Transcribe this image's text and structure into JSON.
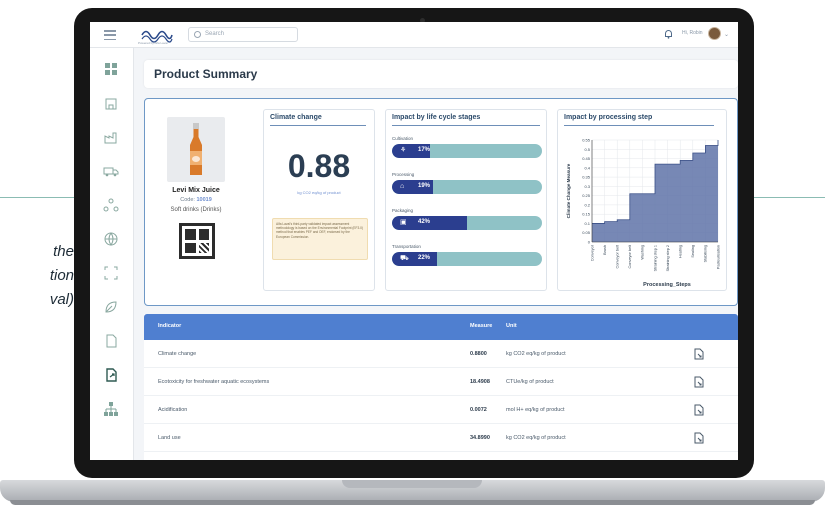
{
  "caption": {
    "lines": [
      "the",
      "tion",
      "val)"
    ]
  },
  "topbar": {
    "search_placeholder": "Search",
    "user_label": "Hi, Robin",
    "logo_tagline": "Powered by Alfa Laval"
  },
  "page_title": "Product Summary",
  "product": {
    "name": "Levi Mix Juice",
    "code_label": "Code:",
    "code_value": "10019",
    "category": "Soft drinks (Drinks)"
  },
  "climate": {
    "title": "Climate change",
    "value": "0.88",
    "unit": "kg CO2 eq/kg of product",
    "note": "Alfa Laval's third-party validated impact assessment methodology is based on the Environmental Footprint (EF3.0) method that enables PEF and OEF, endorsed by the European Commission."
  },
  "stages": {
    "title": "Impact by life cycle stages",
    "items": [
      {
        "label": "Cultivation",
        "icon": "sprout-icon",
        "percent_text": "17%",
        "percent": 17
      },
      {
        "label": "Processing",
        "icon": "factory-icon",
        "percent_text": "19%",
        "percent": 19
      },
      {
        "label": "Packaging",
        "icon": "package-icon",
        "percent_text": "42%",
        "percent": 42
      },
      {
        "label": "Transportation",
        "icon": "truck-icon",
        "percent_text": "22%",
        "percent": 22
      }
    ],
    "colors": {
      "track": "#8fc2c6",
      "fill": "#2b3e8f"
    }
  },
  "processing": {
    "title": "Impact by processing step"
  },
  "chart_data": {
    "type": "area",
    "title": "Impact by processing step",
    "xlabel": "Processing_Steps",
    "ylabel": "Climate Change Measure",
    "categories": [
      "Conveyor",
      "Brush",
      "Conveyor belt",
      "Conveyor belt",
      "Washing",
      "Straining step 1",
      "Straining step 2",
      "Heating",
      "Sealing",
      "Stabilising",
      "Pasteurisation"
    ],
    "values": [
      0.1,
      0.11,
      0.12,
      0.26,
      0.26,
      0.42,
      0.42,
      0.44,
      0.48,
      0.52,
      0.55
    ],
    "y_ticks": [
      "0",
      "0.05",
      "0.1",
      "0.15",
      "0.2",
      "0.25",
      "0.3",
      "0.35",
      "0.4",
      "0.45",
      "0.5",
      "0.55"
    ],
    "ylim": [
      0,
      0.55
    ],
    "grid": true,
    "fill_color": "#5f73a8",
    "line_color": "#3a4f86"
  },
  "table": {
    "headers": [
      "Indicator",
      "Measure",
      "Unit"
    ],
    "rows": [
      {
        "indicator": "Climate change",
        "measure": "0.8800",
        "unit": "kg CO2 eq/kg of product"
      },
      {
        "indicator": "Ecotoxicity for freshwater aquatic ecosystems",
        "measure": "18.4908",
        "unit": "CTUe/kg of product"
      },
      {
        "indicator": "Acidification",
        "measure": "0.0072",
        "unit": "mol H+ eq/kg of product"
      },
      {
        "indicator": "Land use",
        "measure": "34.8990",
        "unit": "kg CO2 eq/kg of product"
      }
    ],
    "header_color": "#4f7fd0"
  },
  "sidebar": {
    "items": [
      "dashboard-icon",
      "building-icon",
      "factory-icon",
      "truck-icon",
      "network-icon",
      "globe-icon",
      "expand-icon",
      "leaf-icon",
      "document-icon",
      "export-icon",
      "hierarchy-icon"
    ]
  }
}
